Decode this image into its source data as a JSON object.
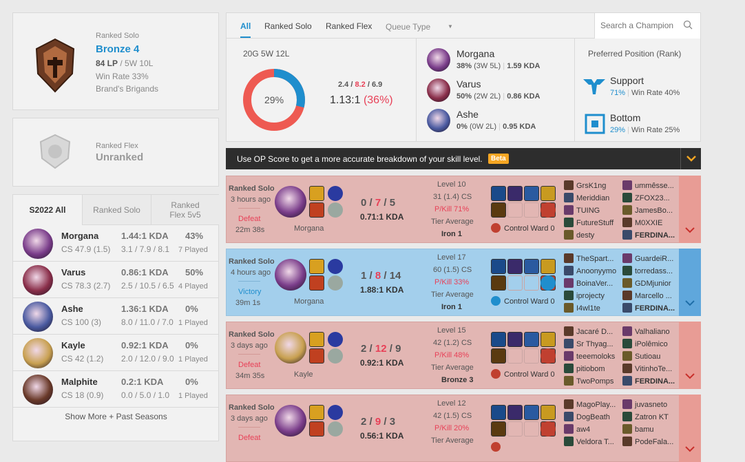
{
  "ranked_solo": {
    "label": "Ranked Solo",
    "tier": "Bronze 4",
    "lp": "84 LP",
    "record": " / 5W 10L",
    "winrate": "Win Rate 33%",
    "league": "Brand's Brigands"
  },
  "ranked_flex": {
    "label": "Ranked Flex",
    "tier": "Unranked"
  },
  "season_tabs": [
    "S2022 All",
    "Ranked Solo",
    "Ranked Flex 5v5"
  ],
  "season_champs": [
    {
      "name": "Morgana",
      "kda": "1.44:1 KDA",
      "wr": "43%",
      "cs": "CS 47.9 (1.5)",
      "kd": "3.1 / 7.9 / 8.1",
      "played": "7 Played",
      "color": "#7a3d8a"
    },
    {
      "name": "Varus",
      "kda": "0.86:1 KDA",
      "wr": "50%",
      "cs": "CS 78.3 (2.7)",
      "kd": "2.5 / 10.5 / 6.5",
      "played": "4 Played",
      "color": "#8a2f4a"
    },
    {
      "name": "Ashe",
      "kda": "1.36:1 KDA",
      "wr": "0%",
      "cs": "CS 100 (3)",
      "kd": "8.0 / 11.0 / 7.0",
      "played": "1 Played",
      "color": "#4a5aa0"
    },
    {
      "name": "Kayle",
      "kda": "0.92:1 KDA",
      "wr": "0%",
      "cs": "CS 42 (1.2)",
      "kd": "2.0 / 12.0 / 9.0",
      "played": "1 Played",
      "color": "#c8a050"
    },
    {
      "name": "Malphite",
      "kda": "0.2:1 KDA",
      "wr": "0%",
      "cs": "CS 18 (0.9)",
      "kd": "0.0 / 5.0 / 1.0",
      "played": "1 Played",
      "color": "#6a3a2a"
    }
  ],
  "show_more": "Show More + Past Seasons",
  "top_tabs": [
    "All",
    "Ranked Solo",
    "Ranked Flex"
  ],
  "queue_type": "Queue Type",
  "search_placeholder": "Search a Champion",
  "summary": {
    "record": "20G 5W 12L",
    "donut_pct": "29%",
    "win_fraction": 0.29,
    "kills": "2.4",
    "deaths": "8.2",
    "assists": "6.9",
    "ratio": "1.13:1",
    "ratio_pct": "(36%)"
  },
  "top_champs": [
    {
      "name": "Morgana",
      "wr": "38%",
      "wl": "(3W 5L)",
      "kda": "1.59 KDA",
      "color": "#7a3d8a"
    },
    {
      "name": "Varus",
      "wr": "50%",
      "wl": "(2W 2L)",
      "kda": "0.86 KDA",
      "color": "#8a2f4a"
    },
    {
      "name": "Ashe",
      "wr": "0%",
      "wl": "(0W 2L)",
      "kda": "0.95 KDA",
      "color": "#4a5aa0"
    }
  ],
  "preferred": {
    "title": "Preferred Position (Rank)",
    "positions": [
      {
        "name": "Support",
        "pct": "71%",
        "wr": "Win Rate 40%"
      },
      {
        "name": "Bottom",
        "pct": "29%",
        "wr": "Win Rate 25%"
      }
    ]
  },
  "op_banner": {
    "text": "Use OP Score to get a more accurate breakdown of your skill level.",
    "badge": "Beta"
  },
  "matches": [
    {
      "queue": "Ranked Solo",
      "ago": "3 hours ago",
      "result": "Defeat",
      "duration": "22m 38s",
      "champ": "Morgana",
      "k": "0",
      "d": "7",
      "a": "5",
      "kda": "0.71:1 KDA",
      "level": "Level 10",
      "cs": "31 (1.4) CS",
      "pkill": "P/Kill 71%",
      "tier_label": "Tier Average",
      "tier": "Iron 1",
      "ward": "Control Ward 0",
      "win": false,
      "color": "#7a3d8a",
      "team1": [
        "GrsK1ng",
        "Meriddian",
        "TUING",
        "FutureStuff",
        "desty"
      ],
      "team2": [
        "ummêsse...",
        "ZFOX23...",
        "JamesBo...",
        "M0XXIE",
        "FERDINA..."
      ]
    },
    {
      "queue": "Ranked Solo",
      "ago": "4 hours ago",
      "result": "Victory",
      "duration": "39m 1s",
      "champ": "Morgana",
      "k": "1",
      "d": "8",
      "a": "14",
      "kda": "1.88:1 KDA",
      "level": "Level 17",
      "cs": "60 (1.5) CS",
      "pkill": "P/Kill 33%",
      "tier_label": "Tier Average",
      "tier": "Iron 1",
      "ward": "Control Ward 0",
      "win": true,
      "color": "#7a3d8a",
      "team1": [
        "TheSpart...",
        "Anoonyymo",
        "BoinaVer...",
        "iprojecty",
        "I4wl1te"
      ],
      "team2": [
        "GuardeiR...",
        "torredass...",
        "GDMjunior",
        "Marcello ...",
        "FERDINA..."
      ]
    },
    {
      "queue": "Ranked Solo",
      "ago": "3 days ago",
      "result": "Defeat",
      "duration": "34m 35s",
      "champ": "Kayle",
      "k": "2",
      "d": "12",
      "a": "9",
      "kda": "0.92:1 KDA",
      "level": "Level 15",
      "cs": "42 (1.2) CS",
      "pkill": "P/Kill 48%",
      "tier_label": "Tier Average",
      "tier": "Bronze 3",
      "ward": "Control Ward 0",
      "win": false,
      "color": "#c8a050",
      "team1": [
        "Jacaré D...",
        "Sr Thyag...",
        "teeemoloks",
        "pitiobom",
        "TwoPomps"
      ],
      "team2": [
        "Valhaliano",
        "iPolêmico",
        "Sutioau",
        "VitinhoTe...",
        "FERDINA..."
      ]
    },
    {
      "queue": "Ranked Solo",
      "ago": "3 days ago",
      "result": "Defeat",
      "duration": "",
      "champ": "",
      "k": "2",
      "d": "9",
      "a": "3",
      "kda": "0.56:1 KDA",
      "level": "Level 12",
      "cs": "42 (1.5) CS",
      "pkill": "P/Kill 20%",
      "tier_label": "Tier Average",
      "tier": "",
      "ward": "",
      "win": false,
      "color": "#7a3d8a",
      "team1": [
        "MagoPlay...",
        "DogBeath",
        "aw4",
        "Veldora T..."
      ],
      "team2": [
        "juvasneto",
        "Zatron KT",
        "bamu",
        "PodeFala..."
      ]
    }
  ],
  "colors": {
    "win_bg": "#a3cfec",
    "win_side": "#5fa7dc",
    "loss_bg": "#e2b6b3",
    "loss_side": "#e89c95",
    "accent": "#1f8ecd",
    "red": "#e84057"
  }
}
